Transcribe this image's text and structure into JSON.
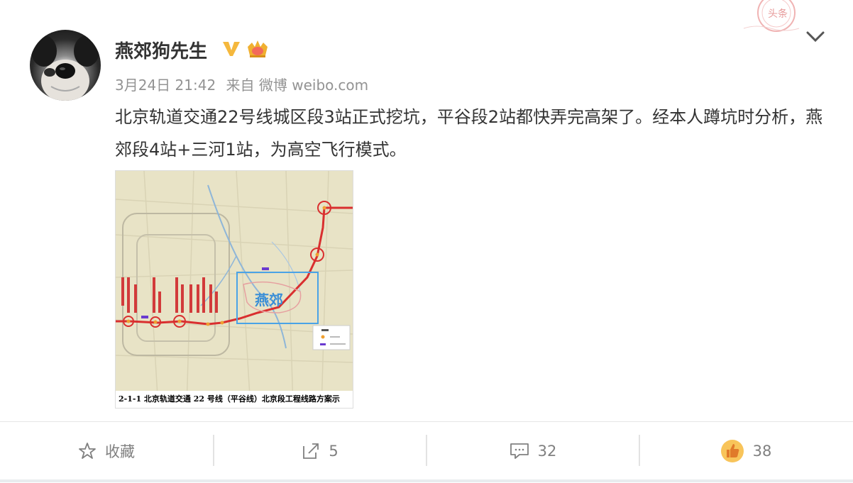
{
  "post": {
    "username": "燕郊狗先生",
    "date": "3月24日 21:42",
    "source": "来自 微博 weibo.com",
    "text": "北京轨道交通22号线城区段3站正式挖坑，平谷段2站都快弄完高架了。经本人蹲坑时分析，燕郊段4站+三河1站，为高空飞行模式。",
    "image": {
      "map_label": "燕郊",
      "caption": "2-1-1  北京轨道交通 22 号线（平谷线）北京段工程线路方案示"
    },
    "stamp_text": "头条"
  },
  "actions": {
    "favorite_label": "收藏",
    "repost_count": "5",
    "comment_count": "32",
    "like_count": "38"
  },
  "icons": {
    "favorite": "star-icon",
    "repost": "share-arrow-icon",
    "comment": "comment-bubble-icon",
    "like": "thumbs-up-icon",
    "more": "chevron-down-icon",
    "verified": "verified-v-icon",
    "vip": "crown-icon"
  },
  "colors": {
    "text": "#333333",
    "meta": "#939393",
    "action": "#808080",
    "verified": "#f5b83d",
    "map_accent": "#3b8fd6",
    "route": "#d92f2f"
  }
}
